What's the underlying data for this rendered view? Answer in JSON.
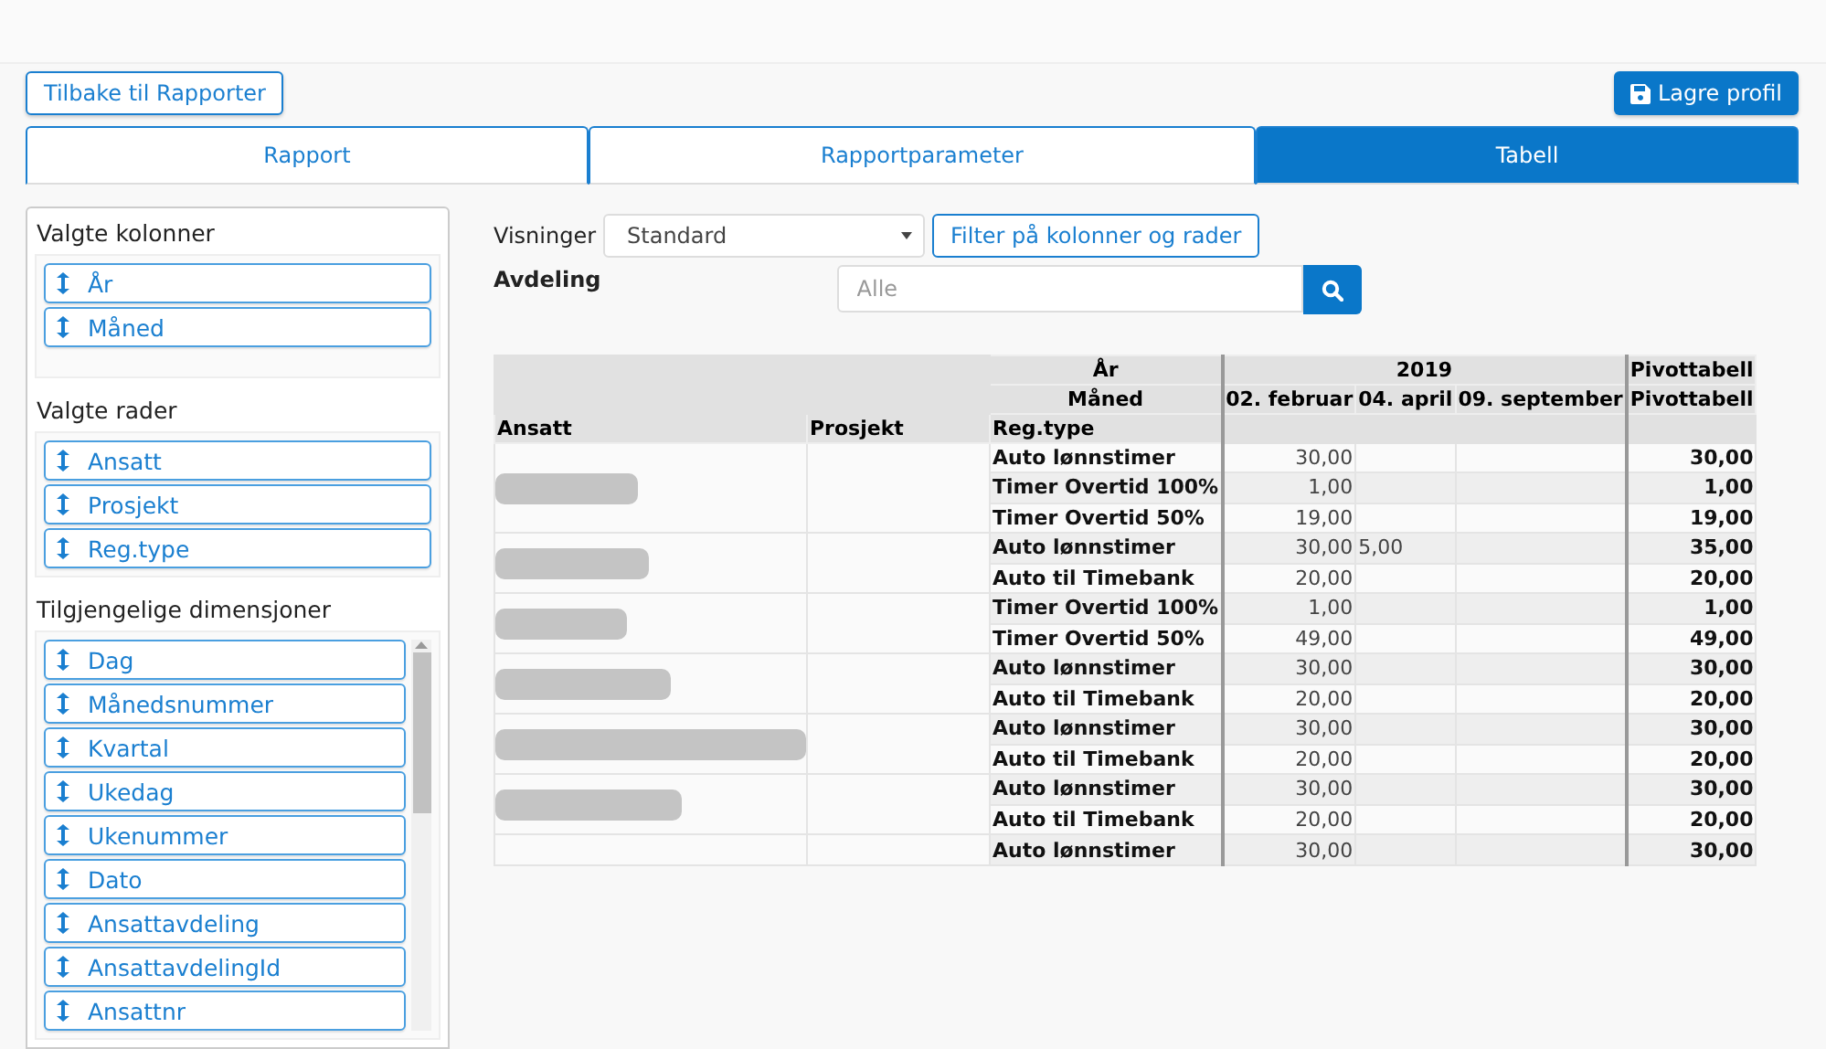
{
  "back_button": "Tilbake til Rapporter",
  "save_button": "Lagre profil",
  "tabs": [
    {
      "label": "Rapport",
      "selected": false
    },
    {
      "label": "Rapportparameter",
      "selected": false
    },
    {
      "label": "Tabell",
      "selected": true
    }
  ],
  "sidebar": {
    "sections": [
      {
        "title": "Valgte kolonner",
        "scroll": false,
        "items": [
          "År",
          "Måned"
        ]
      },
      {
        "title": "Valgte rader",
        "scroll": false,
        "items": [
          "Ansatt",
          "Prosjekt",
          "Reg.type"
        ]
      },
      {
        "title": "Tilgjengelige dimensjoner",
        "scroll": true,
        "items": [
          "Dag",
          "Månedsnummer",
          "Kvartal",
          "Ukedag",
          "Ukenummer",
          "Dato",
          "Ansattavdeling",
          "AnsattavdelingId",
          "Ansattnr"
        ]
      }
    ]
  },
  "views": {
    "label": "Visninger",
    "value": "Standard"
  },
  "filter_button": "Filter på kolonner og rader",
  "department": {
    "label": "Avdeling",
    "placeholder": "Alle"
  },
  "table": {
    "col_dims": [
      {
        "label": "År",
        "values": [
          "2019"
        ],
        "total": "Pivottabell"
      },
      {
        "label": "Måned",
        "values": [
          "02. februar",
          "04. april",
          "09. september"
        ],
        "total": "Pivottabell"
      }
    ],
    "row_dims": [
      "Ansatt",
      "Prosjekt",
      "Reg.type"
    ],
    "groups": [
      {
        "rows": [
          {
            "type": "Auto lønnstimer",
            "month_1": "30,00",
            "total": "30,00"
          },
          {
            "type": "Timer Overtid 100%",
            "month_1": "1,00",
            "total": "1,00"
          },
          {
            "type": "Timer Overtid 50%",
            "month_1": "19,00",
            "total": "19,00"
          }
        ]
      },
      {
        "rows": [
          {
            "type": "Auto lønnstimer",
            "month_1": "30,00",
            "month_2": "5,00",
            "total": "35,00"
          },
          {
            "type": "Auto til Timebank",
            "month_1": "20,00",
            "total": "20,00"
          }
        ]
      },
      {
        "rows": [
          {
            "type": "Timer Overtid 100%",
            "month_1": "1,00",
            "total": "1,00"
          },
          {
            "type": "Timer Overtid 50%",
            "month_1": "49,00",
            "total": "49,00"
          }
        ]
      },
      {
        "rows": [
          {
            "type": "Auto lønnstimer",
            "month_1": "30,00",
            "total": "30,00"
          },
          {
            "type": "Auto til Timebank",
            "month_1": "20,00",
            "total": "20,00"
          }
        ]
      },
      {
        "rows": [
          {
            "type": "Auto lønnstimer",
            "month_1": "30,00",
            "total": "30,00"
          },
          {
            "type": "Auto til Timebank",
            "month_1": "20,00",
            "total": "20,00"
          }
        ]
      },
      {
        "rows": [
          {
            "type": "Auto lønnstimer",
            "month_1": "30,00",
            "total": "30,00"
          },
          {
            "type": "Auto til Timebank",
            "month_1": "20,00",
            "total": "20,00"
          }
        ]
      },
      {
        "rows": [
          {
            "type": "Auto lønnstimer",
            "month_1": "30,00",
            "total": "30,00"
          }
        ]
      }
    ]
  }
}
